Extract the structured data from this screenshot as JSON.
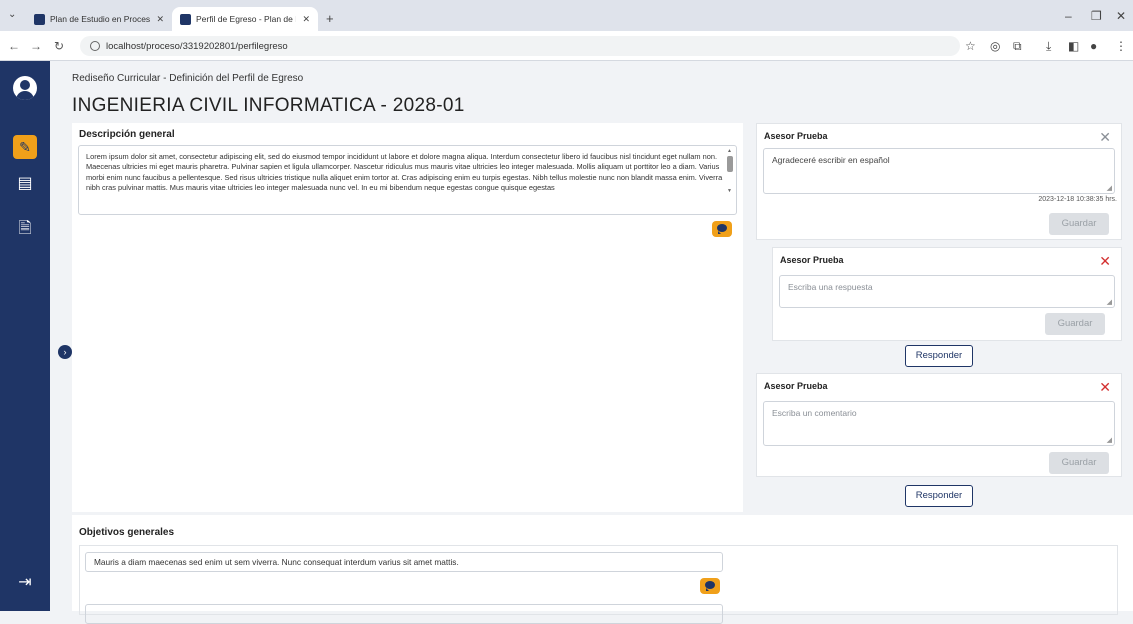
{
  "browser": {
    "tabs": [
      {
        "title": "Plan de Estudio en Proceso - Si"
      },
      {
        "title": "Perfil de Egreso - Plan de Estud"
      }
    ],
    "url": "localhost/proceso/3319202801/perfilegreso",
    "icons": [
      "tab-dropdown-icon",
      "new-tab-icon",
      "minimize-icon",
      "restore-icon",
      "close-icon",
      "back-icon",
      "forward-icon",
      "reload-icon",
      "site-info-icon",
      "bookmark-star-icon",
      "extension-icon",
      "extensions-puzzle-icon",
      "download-icon",
      "sidepanel-icon",
      "profile-icon",
      "menu-icon"
    ]
  },
  "sidebar": {
    "icons": [
      "user-avatar-icon",
      "edit-icon",
      "document-list-icon",
      "file-icon",
      "logout-icon",
      "expand-chevron-icon"
    ]
  },
  "header": {
    "breadcrumb": "Rediseño Curricular - Definición del Perfil de Egreso",
    "title": "INGENIERIA CIVIL INFORMATICA - 2028-01"
  },
  "description": {
    "heading": "Descripción general",
    "text": "Lorem ipsum dolor sit amet, consectetur adipiscing elit, sed do eiusmod tempor incididunt ut labore et dolore magna aliqua. Interdum consectetur libero id faucibus nisl tincidunt eget nullam non. Maecenas ultricies mi eget mauris pharetra. Pulvinar sapien et ligula ullamcorper. Nascetur ridiculus mus mauris vitae ultricies leo integer malesuada. Mollis aliquam ut porttitor leo a diam. Varius morbi enim nunc faucibus a pellentesque. Sed risus ultricies tristique nulla aliquet enim tortor at. Cras adipiscing enim eu turpis egestas. Nibh tellus molestie nunc non blandit massa enim. Viverra nibh cras pulvinar mattis. Mus mauris vitae ultricies leo integer malesuada nunc vel. In eu mi bibendum neque egestas congue quisque egestas"
  },
  "comments": [
    {
      "author": "Asesor Prueba",
      "text": "Agradeceré escribir en español",
      "date": "2023-12-18 10:38:35 hrs.",
      "save": "Guardar"
    },
    {
      "author": "Asesor Prueba",
      "placeholder": "Escriba una respuesta",
      "save": "Guardar",
      "reply": "Responder"
    },
    {
      "author": "Asesor Prueba",
      "placeholder": "Escriba un comentario",
      "save": "Guardar",
      "reply": "Responder"
    }
  ],
  "objectives": {
    "heading": "Objetivos generales",
    "item1": "Mauris a diam maecenas sed enim ut sem viverra. Nunc consequat interdum varius sit amet mattis."
  },
  "colors": {
    "sidebar": "#1f3566",
    "accent": "#f0a01a",
    "close_red": "#d32f2f",
    "close_grey": "#8a8f96"
  }
}
